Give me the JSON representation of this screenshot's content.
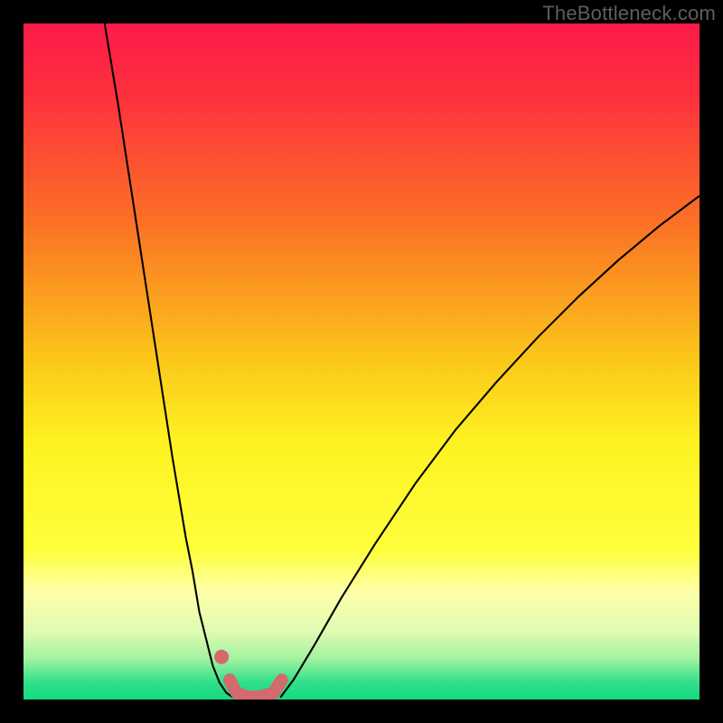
{
  "watermark": "TheBottleneck.com",
  "chart_data": {
    "type": "line",
    "title": "",
    "xlabel": "",
    "ylabel": "",
    "xlim": [
      0,
      100
    ],
    "ylim": [
      0,
      100
    ],
    "grid": false,
    "legend": false,
    "gradient_stops": [
      {
        "pos": 0.0,
        "color": "#fd1b49"
      },
      {
        "pos": 0.1,
        "color": "#fd2f3e"
      },
      {
        "pos": 0.3,
        "color": "#fb7325"
      },
      {
        "pos": 0.5,
        "color": "#fbc81a"
      },
      {
        "pos": 0.62,
        "color": "#fef221"
      },
      {
        "pos": 0.78,
        "color": "#feff3c"
      },
      {
        "pos": 0.84,
        "color": "#feffa9"
      },
      {
        "pos": 0.9,
        "color": "#e0fbb2"
      },
      {
        "pos": 0.94,
        "color": "#a1f2a0"
      },
      {
        "pos": 0.975,
        "color": "#2fe089"
      },
      {
        "pos": 1.0,
        "color": "#16d980"
      }
    ],
    "series": [
      {
        "name": "left-curve",
        "stroke": "#000000",
        "width": 2.1,
        "x": [
          12,
          14,
          16,
          18,
          20,
          22,
          24,
          25,
          26,
          27,
          28,
          29,
          30,
          31
        ],
        "y": [
          100,
          88,
          75,
          62,
          49,
          36,
          24,
          19,
          13,
          9,
          5,
          2.5,
          1,
          0.3
        ]
      },
      {
        "name": "right-curve",
        "stroke": "#000000",
        "width": 2.1,
        "x": [
          38,
          40,
          43,
          47,
          52,
          58,
          64,
          70,
          76,
          82,
          88,
          94,
          100
        ],
        "y": [
          0.3,
          3,
          8,
          15,
          23,
          32,
          40,
          47,
          53.5,
          59.5,
          65,
          70,
          74.5
        ]
      },
      {
        "name": "marker-band",
        "stroke": "#d36a6e",
        "width": 14,
        "linecap": "round",
        "x": [
          30.5,
          31.5,
          33,
          35,
          37,
          38.2
        ],
        "y": [
          2.9,
          1.0,
          0.4,
          0.4,
          1.0,
          2.9
        ]
      },
      {
        "name": "marker-dot",
        "type": "scatter",
        "color": "#d36a6e",
        "radius": 8,
        "x": [
          29.3
        ],
        "y": [
          6.3
        ]
      }
    ]
  }
}
